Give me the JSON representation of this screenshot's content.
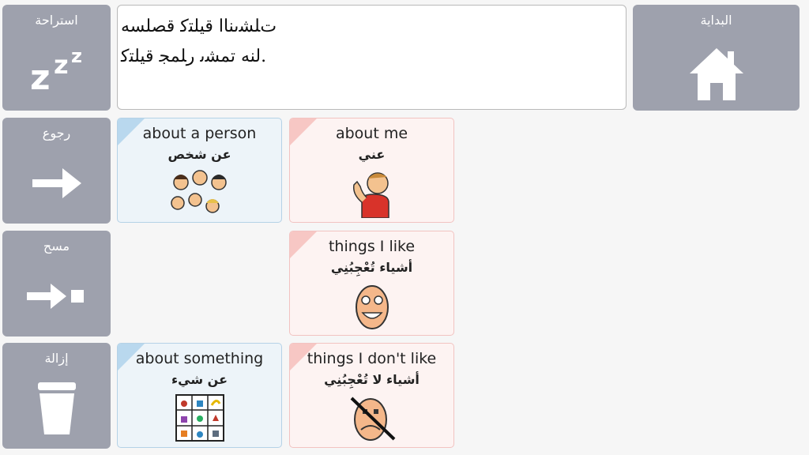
{
  "sidebar": {
    "rest": {
      "label": "استراحة",
      "icon": "zzz-icon"
    },
    "back": {
      "label": "رجوع",
      "icon": "arrow-right-icon"
    },
    "clear": {
      "label": "مسح",
      "icon": "arrow-clear-icon"
    },
    "remove": {
      "label": "إزالة",
      "icon": "trash-icon"
    }
  },
  "home": {
    "label": "البداية",
    "icon": "home-icon"
  },
  "message": {
    "lines": [
      "ﺕﻠﺸﯨﻨﺎﺍ ﻗﯿﻠﺘﮐ ﻗﺼﻠﺴﻪ",
      "ﻟﻨﻪ ﺗﻤﺸﯨ ﺭﻠﻤﺠ ﻗﯿﻠﺘﮐ."
    ]
  },
  "tiles": [
    {
      "en": "about a person",
      "ar": "عن شخص",
      "color": "blue",
      "icon": "people-group-icon"
    },
    {
      "en": "about me",
      "ar": "عني",
      "color": "pink",
      "icon": "person-thumb-icon"
    },
    {
      "en": "things I like",
      "ar": "أشياء تُعْجِبُنِي",
      "color": "pink",
      "icon": "happy-face-icon"
    },
    {
      "en": "about something",
      "ar": "عن شيء",
      "color": "blue",
      "icon": "object-grid-icon"
    },
    {
      "en": "things I don't like",
      "ar": "أشياء لا تُعْجِبُنِي",
      "color": "pink",
      "icon": "unhappy-face-crossed-icon"
    }
  ],
  "colors": {
    "sidebar": "#9ea1ad",
    "blue_tile": "#edf4f9",
    "pink_tile": "#fdf3f2",
    "background": "#f6f6f6"
  }
}
